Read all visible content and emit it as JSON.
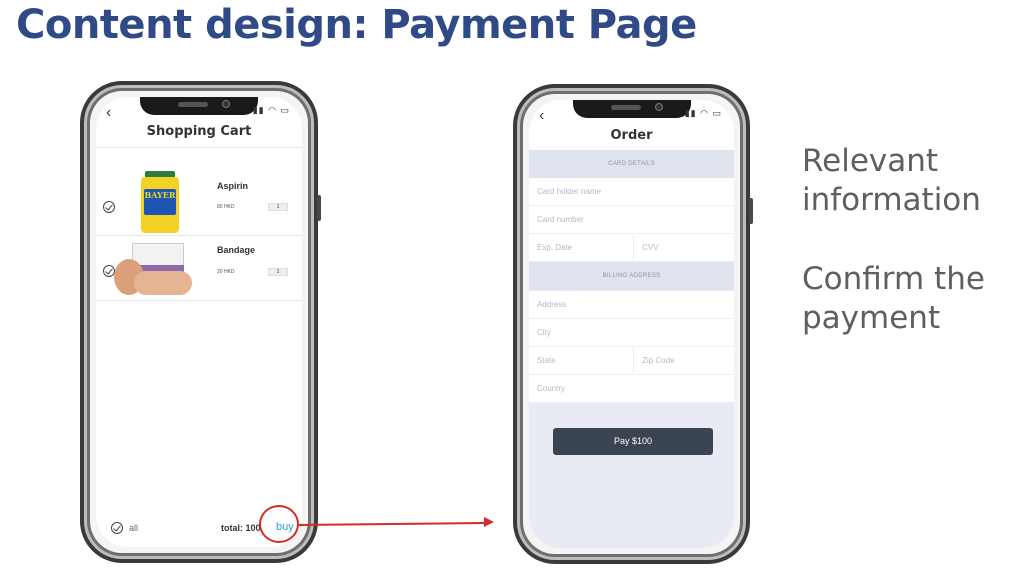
{
  "slide": {
    "title": "Content design: Payment Page",
    "bullets": [
      "Relevant information",
      "Confirm the payment"
    ]
  },
  "cart_screen": {
    "title": "Shopping Cart",
    "items": [
      {
        "name": "Aspirin",
        "price": "80 HKD",
        "qty": "1",
        "image_label": "BAYER"
      },
      {
        "name": "Bandage",
        "price": "20 HKD",
        "qty": "1"
      }
    ],
    "select_all_label": "all",
    "total_label": "total: 100",
    "buy_label": "buy"
  },
  "order_screen": {
    "title": "Order",
    "card_section": "CARD DETAILS",
    "card_fields": {
      "holder": "Card holder name",
      "number": "Card number",
      "exp": "Exp. Date",
      "cvv": "CVV"
    },
    "billing_section": "BILLING ADDRESS",
    "billing_fields": {
      "address": "Address",
      "city": "City",
      "state": "State",
      "zip": "Zip Code",
      "country": "Country"
    },
    "pay_label": "Pay $100"
  },
  "colors": {
    "title": "#2f4a86",
    "accent_red": "#d42a2a",
    "buy_blue": "#2a9fd6",
    "pay_button": "#3b4552",
    "form_bg": "#e8ebf4"
  }
}
